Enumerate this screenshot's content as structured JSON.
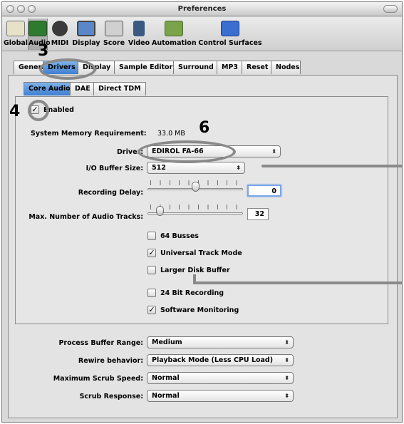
{
  "window": {
    "title": "Preferences"
  },
  "toolbar": {
    "items": [
      {
        "label": "Global",
        "icon": "global-icon",
        "color": "#e7e1c8"
      },
      {
        "label": "Audio",
        "icon": "audio-icon",
        "color": "#3a9a3a"
      },
      {
        "label": "MIDI",
        "icon": "midi-icon",
        "color": "#3a3a3a"
      },
      {
        "label": "Display",
        "icon": "display-icon",
        "color": "#5a87c9"
      },
      {
        "label": "Score",
        "icon": "score-icon",
        "color": "#8e8e8e"
      },
      {
        "label": "Video",
        "icon": "video-icon",
        "color": "#3a5a82"
      },
      {
        "label": "Automation",
        "icon": "automation-icon",
        "color": "#7aa34a"
      },
      {
        "label": "Control Surfaces",
        "icon": "control-surfaces-icon",
        "color": "#3a6ecf"
      }
    ]
  },
  "audio_tabs": [
    "General",
    "Drivers",
    "Display",
    "Sample Editor",
    "Surround",
    "MP3",
    "Reset",
    "Nodes"
  ],
  "driver_tabs": [
    "Core Audio",
    "DAE",
    "Direct TDM"
  ],
  "core_audio": {
    "enabled_label": "Enabled",
    "enabled": true,
    "memory_label": "System Memory Requirement:",
    "memory_value": "33.0 MB",
    "driver_label": "Driver:",
    "driver_value": "EDIROL FA-66",
    "buffer_label": "I/O Buffer Size:",
    "buffer_value": "512",
    "delay_label": "Recording Delay:",
    "delay_value": "0",
    "delay_slider_level": 0.5,
    "tracks_label": "Max. Number of Audio Tracks:",
    "tracks_value": "32",
    "tracks_slider_level": 0.1,
    "checkboxes": [
      {
        "label": "64 Busses",
        "checked": false
      },
      {
        "label": "Universal Track Mode",
        "checked": true
      },
      {
        "label": "Larger Disk Buffer",
        "checked": false
      },
      {
        "label": "24 Bit Recording",
        "checked": false
      },
      {
        "label": "Software Monitoring",
        "checked": true
      }
    ]
  },
  "general": {
    "process_label": "Process Buffer Range:",
    "process_value": "Medium",
    "rewire_label": "Rewire behavior:",
    "rewire_value": "Playback Mode (Less CPU Load)",
    "scrub_speed_label": "Maximum Scrub Speed:",
    "scrub_speed_value": "Normal",
    "scrub_response_label": "Scrub Response:",
    "scrub_response_value": "Normal"
  },
  "callouts": {
    "three": "3",
    "four": "4",
    "six": "6"
  },
  "check_glyph": "✓",
  "popup_arrow_glyph": "⬍"
}
